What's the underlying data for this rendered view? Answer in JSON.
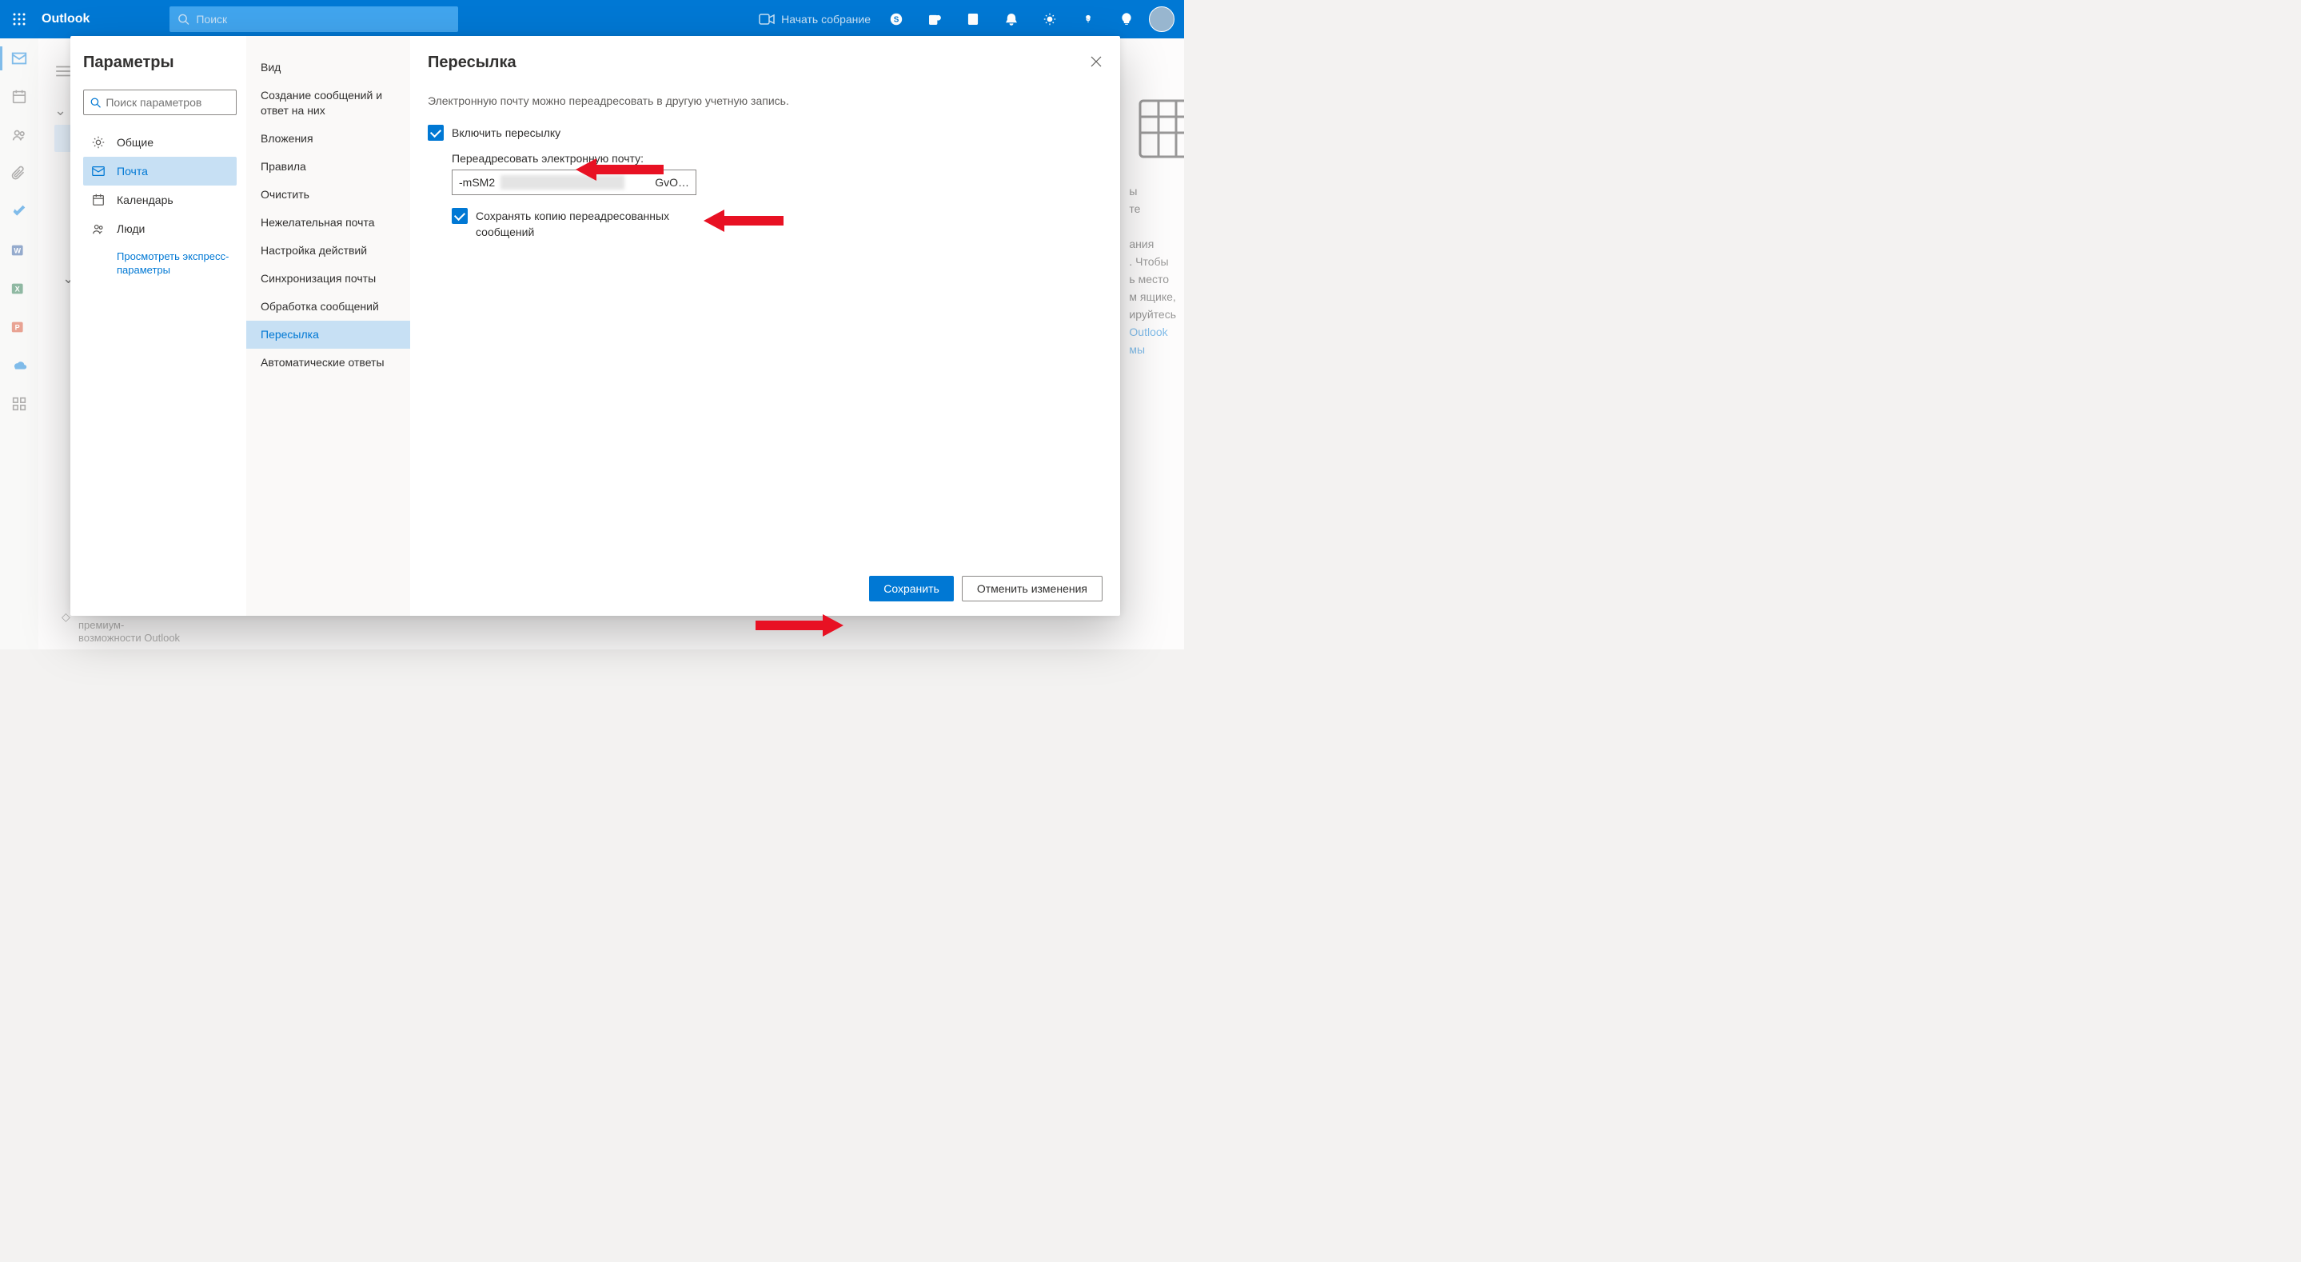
{
  "header": {
    "brand": "Outlook",
    "search_placeholder": "Поиск",
    "meet_label": "Начать собрание"
  },
  "background": {
    "text_lines": [
      "ы",
      "те",
      "",
      "ания",
      ". Чтобы",
      "ь место",
      "м ящике,",
      "ируйтесь"
    ],
    "link1": "Outlook",
    "link2": "мы",
    "premium_line1": "премиум-",
    "premium_line2": "возможности Outlook"
  },
  "settings": {
    "title": "Параметры",
    "search_placeholder": "Поиск параметров",
    "cats": [
      {
        "label": "Общие"
      },
      {
        "label": "Почта"
      },
      {
        "label": "Календарь"
      },
      {
        "label": "Люди"
      }
    ],
    "quick": "Просмотреть экспресс-параметры",
    "opts": [
      "Вид",
      "Создание сообщений и ответ на них",
      "Вложения",
      "Правила",
      "Очистить",
      "Нежелательная почта",
      "Настройка действий",
      "Синхронизация почты",
      "Обработка сообщений",
      "Пересылка",
      "Автоматические ответы"
    ],
    "selected_opt": 9
  },
  "pane": {
    "title": "Пересылка",
    "desc": "Электронную почту можно переадресовать в другую учетную запись.",
    "enable_label": "Включить пересылку",
    "forward_label": "Переадресовать электронную почту:",
    "forward_prefix": "-mSM2",
    "forward_suffix": "GvO…",
    "keep_label": "Сохранять копию переадресованных сообщений",
    "save": "Сохранить",
    "cancel": "Отменить изменения"
  }
}
